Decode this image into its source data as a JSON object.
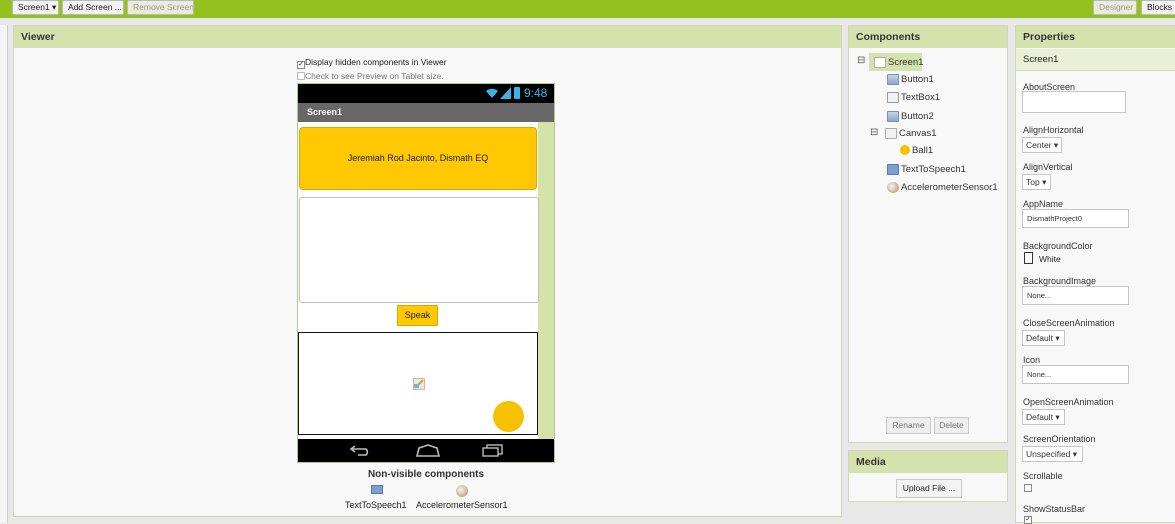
{
  "toolbar": {
    "screen_select": "Screen1",
    "add_screen": "Add Screen ...",
    "remove_screen": "Remove Screen",
    "designer": "Designer",
    "blocks": "Blocks"
  },
  "viewer": {
    "title": "Viewer",
    "display_hidden": "Display hidden components in Viewer",
    "display_hidden_checked": true,
    "tablet_preview": "Check to see Preview on Tablet size.",
    "tablet_preview_checked": false,
    "status_time": "9:48",
    "screen_title": "Screen1",
    "label_text": "Jeremiah Rod Jacinto, Dismath EQ",
    "speak_button": "Speak",
    "nonvisible_title": "Non-visible components",
    "nonvisible": [
      "TextToSpeech1",
      "AccelerometerSensor1"
    ]
  },
  "components": {
    "title": "Components",
    "tree": [
      {
        "label": "Screen1",
        "icon": "screen-icon",
        "level": 0,
        "collapsible": true,
        "selected": true
      },
      {
        "label": "Button1",
        "icon": "button-icon",
        "level": 1
      },
      {
        "label": "TextBox1",
        "icon": "textbox-icon",
        "level": 1
      },
      {
        "label": "Button2",
        "icon": "button-icon",
        "level": 1
      },
      {
        "label": "Canvas1",
        "icon": "canvas-icon",
        "level": 1,
        "collapsible": true
      },
      {
        "label": "Ball1",
        "icon": "ball-icon",
        "level": 2
      },
      {
        "label": "TextToSpeech1",
        "icon": "speech-icon",
        "level": 1
      },
      {
        "label": "AccelerometerSensor1",
        "icon": "accelerometer-icon",
        "level": 1
      }
    ],
    "rename": "Rename",
    "delete": "Delete"
  },
  "media": {
    "title": "Media",
    "upload": "Upload File ..."
  },
  "properties": {
    "title": "Properties",
    "component": "Screen1",
    "about_screen_label": "AboutScreen",
    "about_screen_value": "",
    "align_h_label": "AlignHorizontal",
    "align_h_value": "Center",
    "align_v_label": "AlignVertical",
    "align_v_value": "Top",
    "app_name_label": "AppName",
    "app_name_value": "DismathProject0",
    "bg_color_label": "BackgroundColor",
    "bg_color_value": "White",
    "bg_image_label": "BackgroundImage",
    "bg_image_value": "None...",
    "close_anim_label": "CloseScreenAnimation",
    "close_anim_value": "Default",
    "icon_label": "Icon",
    "icon_value": "None...",
    "open_anim_label": "OpenScreenAnimation",
    "open_anim_value": "Default",
    "orientation_label": "ScreenOrientation",
    "orientation_value": "Unspecified",
    "scrollable_label": "Scrollable",
    "scrollable_checked": false,
    "status_bar_label": "ShowStatusBar",
    "status_bar_checked": true
  },
  "colors": {
    "accent_green": "#94c11f",
    "panel_header": "#d6e2ae",
    "button_yellow": "#ffc800",
    "ball_yellow": "#f5c100"
  }
}
